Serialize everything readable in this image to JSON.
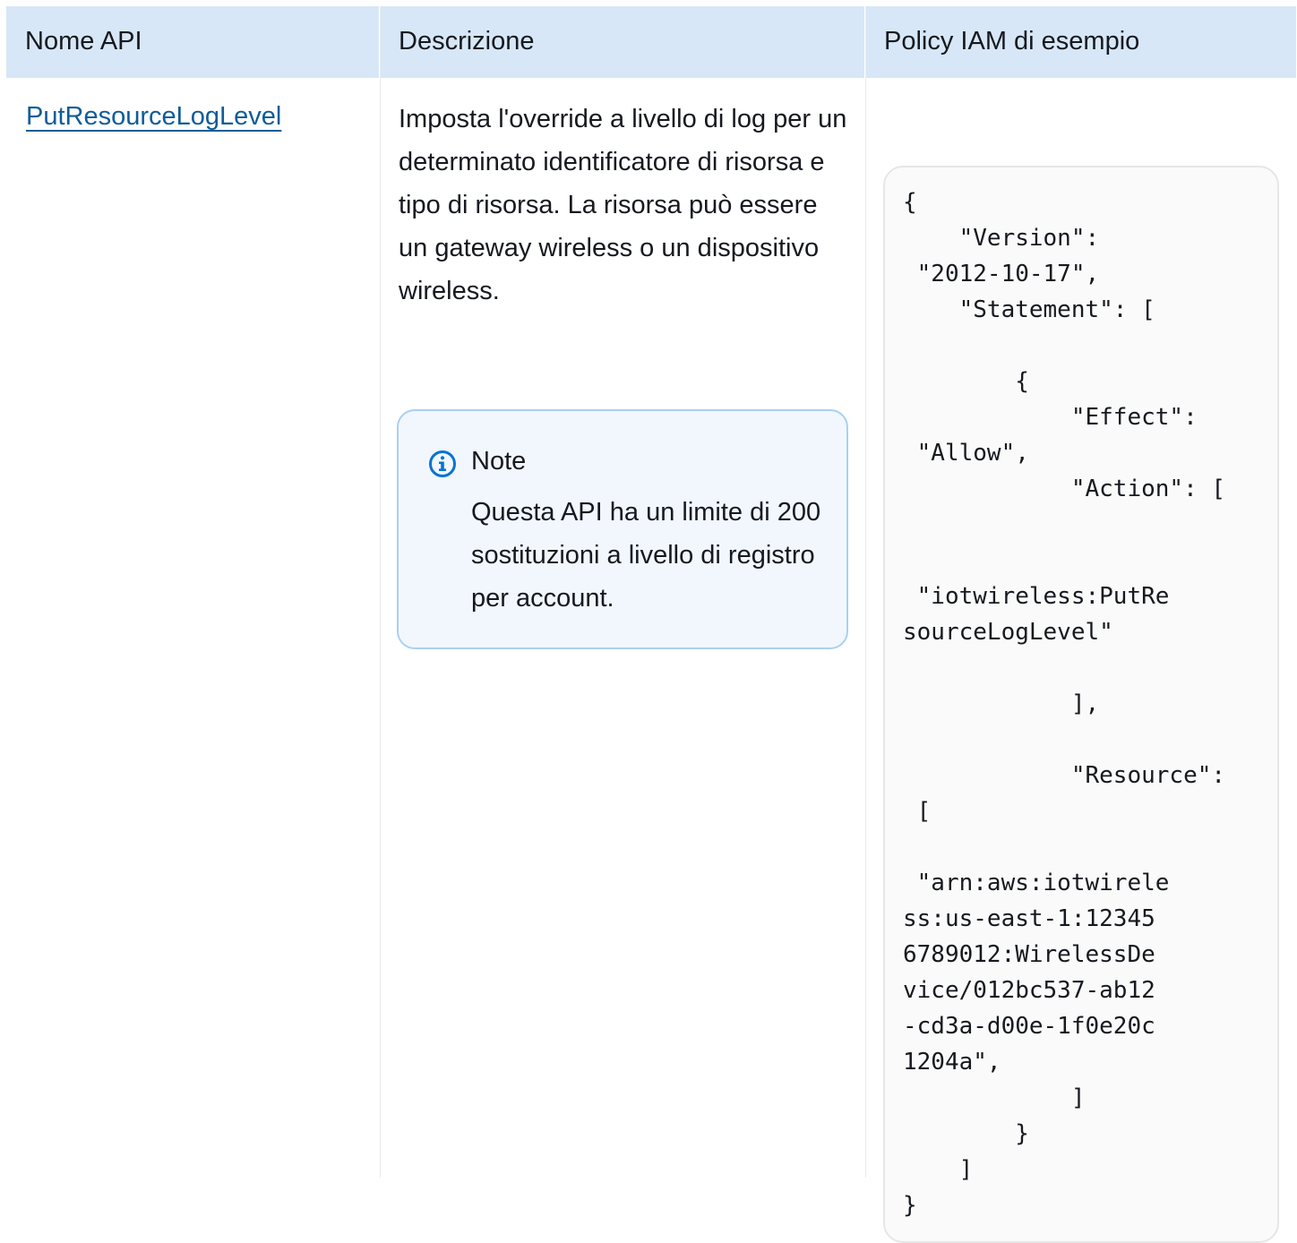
{
  "table": {
    "headers": {
      "api_name": "Nome API",
      "description": "Descrizione",
      "iam_policy": "Policy IAM di esempio"
    },
    "row": {
      "api_link": "PutResourceLogLevel",
      "description": "Imposta l'override a livello di log per un determinato identificatore di risorsa e tipo di risorsa. La risorsa può essere un gateway wireless o un dispositivo wireless.",
      "note": {
        "title": "Note",
        "body": "Questa API ha un limite di 200 sostituzioni a livello di registro per account."
      },
      "policy_code": "{\n    \"Version\":\n \"2012-10-17\",\n    \"Statement\": [\n\n        {\n            \"Effect\":\n \"Allow\",\n            \"Action\": [\n\n\n \"iotwireless:PutRe\nsourceLogLevel\"\n\n            ],\n\n            \"Resource\":\n [\n\n \"arn:aws:iotwirele\nss:us-east-1:12345\n6789012:WirelessDe\nvice/012bc537-ab12\n-cd3a-d00e-1f0e20c\n1204a\",\n            ]\n        }\n    ]\n}"
    }
  },
  "colors": {
    "header_bg": "#d7e7f7",
    "link": "#0f5c99",
    "note_border": "#a9d0f3",
    "note_bg": "#f1f7fd",
    "info_icon": "#0972d3"
  },
  "icons": {
    "note": "info-circle-icon"
  }
}
